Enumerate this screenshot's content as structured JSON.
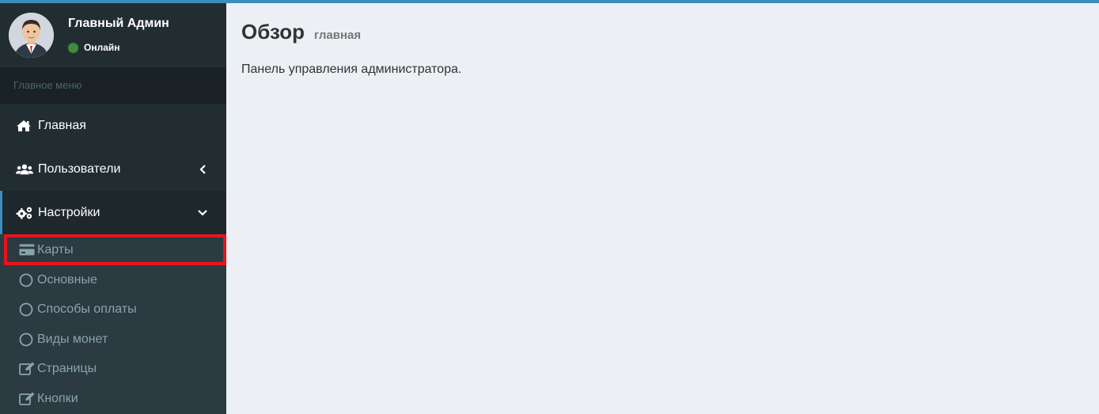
{
  "user": {
    "name": "Главный Админ",
    "status": "Онлайн"
  },
  "sidebar": {
    "header": "Главное меню",
    "items": [
      {
        "label": "Главная",
        "icon": "home-icon"
      },
      {
        "label": "Пользователи",
        "icon": "users-icon",
        "chevron": "chevron-left-icon"
      },
      {
        "label": "Настройки",
        "icon": "gears-icon",
        "chevron": "chevron-down-icon"
      }
    ],
    "submenu": [
      {
        "label": "Карты",
        "icon": "credit-card-icon"
      },
      {
        "label": "Основные",
        "icon": "circle-icon"
      },
      {
        "label": "Способы оплаты",
        "icon": "circle-icon"
      },
      {
        "label": "Виды монет",
        "icon": "circle-icon"
      },
      {
        "label": "Страницы",
        "icon": "edit-icon"
      },
      {
        "label": "Кнопки",
        "icon": "edit-icon"
      }
    ]
  },
  "page": {
    "title": "Обзор",
    "subtitle": "главная",
    "description": "Панель управления администратора."
  },
  "colors": {
    "accent": "#3c8dbc",
    "sidebar_bg": "#222d32",
    "submenu_bg": "#2c3b41",
    "highlight_border": "#e8141b",
    "status_online": "#3c8d3c",
    "content_bg": "#ecf0f5"
  }
}
